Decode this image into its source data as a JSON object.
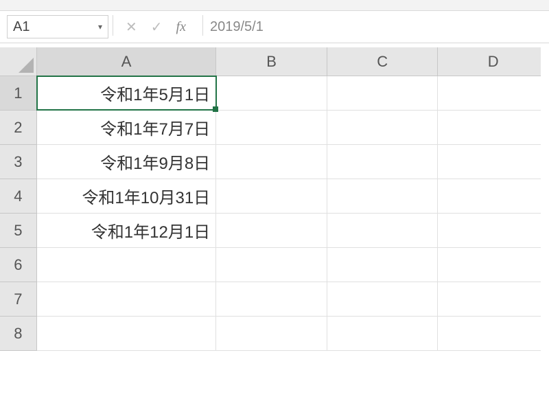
{
  "nameBox": {
    "ref": "A1"
  },
  "formulaBar": {
    "cancel_glyph": "✕",
    "confirm_glyph": "✓",
    "fx_label": "fx",
    "value": "2019/5/1"
  },
  "columns": [
    "A",
    "B",
    "C",
    "D"
  ],
  "selected_column_index": 0,
  "selected_row_index": 0,
  "rows": [
    {
      "n": "1",
      "cells": [
        "令和1年5月1日",
        "",
        "",
        ""
      ]
    },
    {
      "n": "2",
      "cells": [
        "令和1年7月7日",
        "",
        "",
        ""
      ]
    },
    {
      "n": "3",
      "cells": [
        "令和1年9月8日",
        "",
        "",
        ""
      ]
    },
    {
      "n": "4",
      "cells": [
        "令和1年10月31日",
        "",
        "",
        ""
      ]
    },
    {
      "n": "5",
      "cells": [
        "令和1年12月1日",
        "",
        "",
        ""
      ]
    },
    {
      "n": "6",
      "cells": [
        "",
        "",
        "",
        ""
      ]
    },
    {
      "n": "7",
      "cells": [
        "",
        "",
        "",
        ""
      ]
    },
    {
      "n": "8",
      "cells": [
        "",
        "",
        "",
        ""
      ]
    }
  ],
  "active_cell": {
    "row": 0,
    "col": 0
  },
  "colors": {
    "accent": "#217346"
  }
}
